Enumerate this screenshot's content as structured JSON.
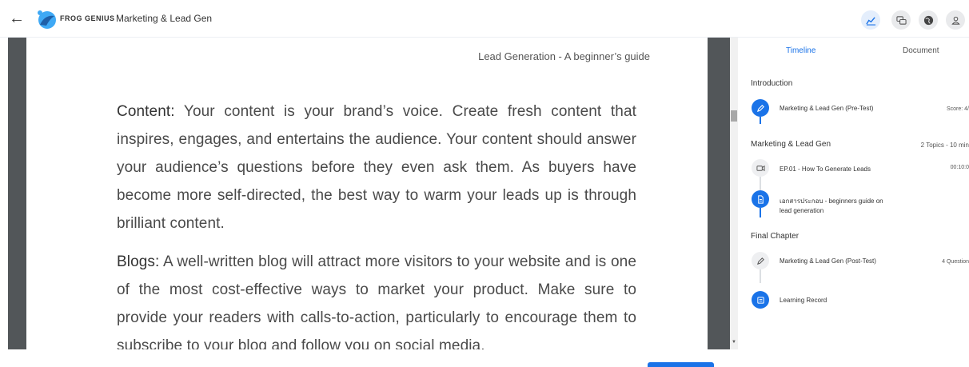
{
  "header": {
    "brand": "FROG GENIUS",
    "course_title": "Marketing & Lead Gen",
    "back_icon": "arrow-left-icon",
    "icons": [
      "chart-icon",
      "chat-icon",
      "globe-icon",
      "user-icon"
    ]
  },
  "document": {
    "page_header": "Lead Generation - A beginner’s guide",
    "paragraphs": [
      {
        "term": "Content:",
        "text": " Your content is your brand’s voice. Create fresh content that inspires, engages, and entertains the audience. Your content should answer your audience’s questions before they even ask them. As buyers have become more self-directed, the best way to warm your leads up is through brilliant content."
      },
      {
        "term": "Blogs:",
        "text": " A well-written blog will attract more visitors to your website and is one of the most cost-effective ways to market your product. Make sure to provide your readers with calls-to-action, particularly to encourage them to subscribe to your blog and follow you on social media."
      }
    ]
  },
  "sidebar": {
    "tabs": {
      "timeline": "Timeline",
      "document": "Document"
    },
    "sections": [
      {
        "title": "Introduction",
        "meta": "",
        "items": [
          {
            "label": "Marketing & Lead Gen (Pre-Test)",
            "meta": "Score: 4/",
            "icon": "pencil-icon",
            "state": "active"
          }
        ]
      },
      {
        "title": "Marketing & Lead Gen",
        "meta": "2 Topics - 10 min",
        "items": [
          {
            "label": "EP.01 - How To Generate Leads",
            "meta": "00:10:0",
            "icon": "video-icon",
            "state": "inactive"
          },
          {
            "label": "เอกสารประกอบ - beginners guide on lead generation",
            "meta": "",
            "icon": "document-icon",
            "state": "active"
          }
        ]
      },
      {
        "title": "Final Chapter",
        "meta": "",
        "items": [
          {
            "label": "Marketing & Lead Gen (Post-Test)",
            "meta": "4 Question",
            "icon": "pencil-icon",
            "state": "inactive"
          },
          {
            "label": "Learning Record",
            "meta": "",
            "icon": "record-icon",
            "state": "active"
          }
        ]
      }
    ]
  },
  "colors": {
    "accent": "#1a73e8",
    "viewer_bg": "#525659"
  }
}
